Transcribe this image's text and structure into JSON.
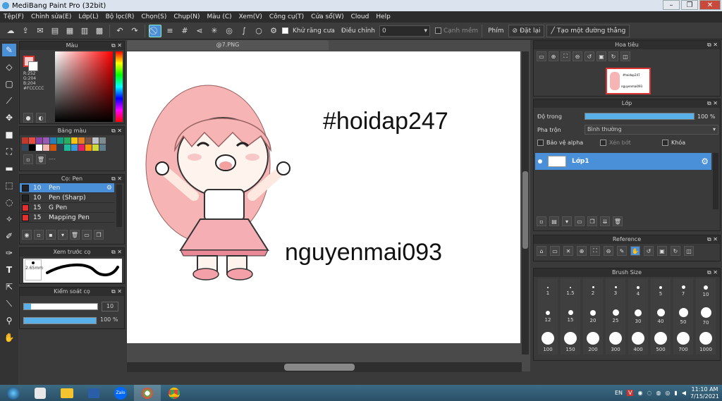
{
  "window": {
    "title": "MediBang Paint Pro (32bit)"
  },
  "menu": [
    "Tệp(F)",
    "Chỉnh sửa(E)",
    "Lớp(L)",
    "Bộ lọc(R)",
    "Chọn(S)",
    "Chụp(N)",
    "Màu (C)",
    "Xem(V)",
    "Công cụ(T)",
    "Cửa sổ(W)",
    "Cloud",
    "Help"
  ],
  "toolbar": {
    "antialias_label": "Khử răng cưa",
    "adjust_label": "Điều chỉnh",
    "adjust_value": "0",
    "edge_label": "Cạnh mềm",
    "phim_label": "Phím",
    "reset_label": "Đặt lại",
    "line_label": "Tạo một đường thẳng"
  },
  "color_panel": {
    "title": "Màu",
    "r": "R:252",
    "g": "G:204",
    "b": "B:204",
    "hex": "#FCCCCC",
    "fg": "#fccccc",
    "bg": "#ffffff"
  },
  "palette": {
    "title": "Bảng màu",
    "colors": [
      "#c0392b",
      "#e74c3c",
      "#8e44ad",
      "#9b59b6",
      "#2980b9",
      "#16a085",
      "#27ae60",
      "#f1c40f",
      "#e67e22",
      "#795548",
      "#bdc3c7",
      "#7f8c8d",
      "#34495e",
      "#000000",
      "#ffffff",
      "#f5b7b1",
      "#d35400",
      "#2c3e50",
      "#1abc9c",
      "#3498db",
      "#e91e63",
      "#ff9800",
      "#cddc39",
      "#607d8b"
    ],
    "footer": "---"
  },
  "brush_panel": {
    "title": "Cọ: Pen",
    "items": [
      {
        "size": "10",
        "name": "Pen",
        "color": "#222222",
        "active": true
      },
      {
        "size": "10",
        "name": "Pen (Sharp)",
        "color": "#222222",
        "active": false
      },
      {
        "size": "15",
        "name": "G Pen",
        "color": "#e03030",
        "active": false
      },
      {
        "size": "15",
        "name": "Mapping Pen",
        "color": "#e03030",
        "active": false
      }
    ]
  },
  "preview_panel": {
    "title": "Xem trước cọ",
    "size": "2.65mm"
  },
  "control_panel": {
    "title": "Kiểm soát cọ",
    "size_value": "10",
    "opacity_value": "100 %",
    "size_fill": 0.1,
    "opacity_fill": 1.0
  },
  "document": {
    "tab": "@7.PNG"
  },
  "canvas": {
    "text1": "#hoidap247",
    "text2": "nguyenmai093"
  },
  "navigator": {
    "title": "Hoa tiêu",
    "thumb_text1": "#hoidap247",
    "thumb_text2": "nguyenmai093"
  },
  "layer_panel": {
    "title": "Lớp",
    "opacity_label": "Độ trong",
    "opacity_value": "100 %",
    "opacity_fill": 1.0,
    "blend_label": "Pha trộn",
    "blend_value": "Bình thường",
    "protect_alpha": "Bảo vệ alpha",
    "clipping": "Xén bớt",
    "lock": "Khóa",
    "layer_name": "Lớp1"
  },
  "reference_panel": {
    "title": "Reference"
  },
  "brush_size_panel": {
    "title": "Brush Size",
    "sizes": [
      "1",
      "1.5",
      "2",
      "3",
      "4",
      "5",
      "7",
      "10",
      "12",
      "15",
      "20",
      "25",
      "30",
      "40",
      "50",
      "70",
      "100",
      "150",
      "200",
      "300",
      "400",
      "500",
      "700",
      "1000"
    ]
  },
  "taskbar": {
    "lang": "EN",
    "time": "11:10 AM",
    "date": "7/15/2021"
  }
}
